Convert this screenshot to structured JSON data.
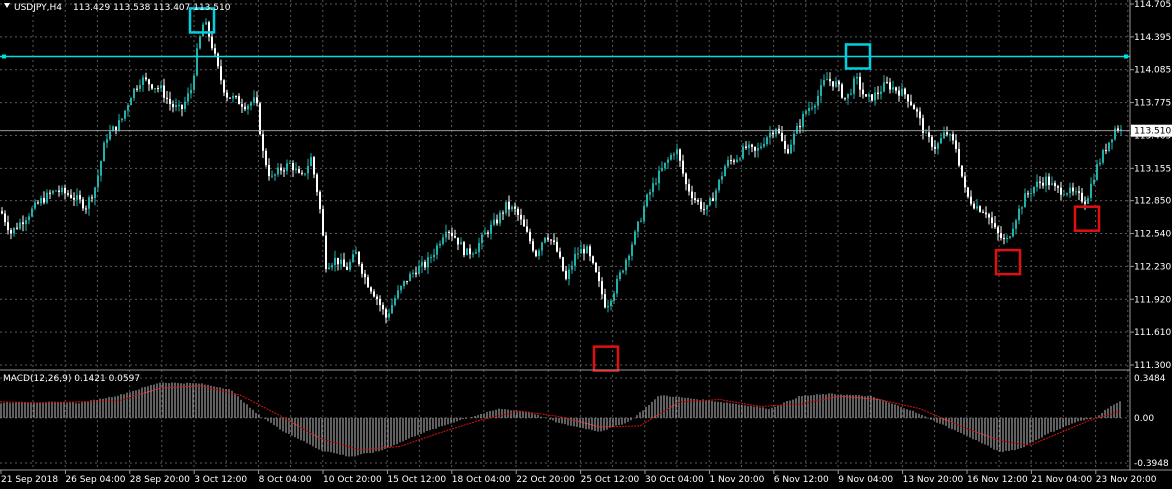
{
  "header": {
    "symbol": "USDJPY,H4",
    "ohlc": "113.429 113.538 113.407 113.510",
    "macd_label": "MACD(12,26,9) 0.1421 0.0597"
  },
  "colors": {
    "background": "#000000",
    "grid": "#5a5a5a",
    "bull": "#20b2aa",
    "bear": "#ffffff",
    "level_line": "#00e0e0",
    "peak_box": "#00d0e0",
    "trough_box": "#e01010",
    "signal": "#e01010",
    "histogram": "#c0c0c0"
  },
  "chart_data": [
    {
      "type": "candlestick",
      "symbol": "USDJPY",
      "timeframe": "H4",
      "ylim": [
        111.3,
        114.705
      ],
      "y_ticks": [
        "114.705",
        "114.395",
        "114.085",
        "113.775",
        "113.465",
        "113.155",
        "112.850",
        "112.540",
        "112.230",
        "111.920",
        "111.610",
        "111.300"
      ],
      "x_ticks": [
        "21 Sep 2018",
        "26 Sep 04:00",
        "28 Sep 20:00",
        "3 Oct 12:00",
        "8 Oct 04:00",
        "10 Oct 20:00",
        "15 Oct 12:00",
        "18 Oct 04:00",
        "22 Oct 20:00",
        "25 Oct 12:00",
        "30 Oct 04:00",
        "1 Nov 20:00",
        "6 Nov 12:00",
        "9 Nov 04:00",
        "13 Nov 20:00",
        "16 Nov 12:00",
        "21 Nov 04:00",
        "23 Nov 20:00"
      ],
      "current_price": "113.510",
      "horizontal_level": 114.21,
      "close_path": [
        [
          0,
          112.75
        ],
        [
          10,
          112.55
        ],
        [
          25,
          112.7
        ],
        [
          40,
          112.85
        ],
        [
          55,
          112.95
        ],
        [
          70,
          112.9
        ],
        [
          85,
          112.8
        ],
        [
          95,
          113.0
        ],
        [
          105,
          113.45
        ],
        [
          120,
          113.6
        ],
        [
          130,
          113.85
        ],
        [
          140,
          114.0
        ],
        [
          150,
          113.95
        ],
        [
          160,
          113.9
        ],
        [
          170,
          113.75
        ],
        [
          180,
          113.7
        ],
        [
          190,
          113.9
        ],
        [
          197,
          114.3
        ],
        [
          203,
          114.55
        ],
        [
          210,
          114.35
        ],
        [
          218,
          114.05
        ],
        [
          225,
          113.85
        ],
        [
          235,
          113.8
        ],
        [
          245,
          113.75
        ],
        [
          255,
          113.8
        ],
        [
          262,
          113.3
        ],
        [
          270,
          113.05
        ],
        [
          280,
          113.15
        ],
        [
          290,
          113.2
        ],
        [
          300,
          113.05
        ],
        [
          310,
          113.25
        ],
        [
          318,
          112.85
        ],
        [
          325,
          112.25
        ],
        [
          335,
          112.3
        ],
        [
          345,
          112.2
        ],
        [
          355,
          112.35
        ],
        [
          365,
          112.1
        ],
        [
          375,
          111.95
        ],
        [
          385,
          111.75
        ],
        [
          395,
          111.95
        ],
        [
          405,
          112.1
        ],
        [
          415,
          112.2
        ],
        [
          425,
          112.25
        ],
        [
          435,
          112.4
        ],
        [
          445,
          112.6
        ],
        [
          455,
          112.5
        ],
        [
          465,
          112.35
        ],
        [
          475,
          112.4
        ],
        [
          485,
          112.55
        ],
        [
          495,
          112.65
        ],
        [
          505,
          112.8
        ],
        [
          515,
          112.75
        ],
        [
          525,
          112.55
        ],
        [
          535,
          112.35
        ],
        [
          545,
          112.55
        ],
        [
          555,
          112.4
        ],
        [
          565,
          112.1
        ],
        [
          575,
          112.35
        ],
        [
          585,
          112.4
        ],
        [
          595,
          112.15
        ],
        [
          605,
          111.85
        ],
        [
          615,
          112.05
        ],
        [
          625,
          112.3
        ],
        [
          635,
          112.55
        ],
        [
          645,
          112.85
        ],
        [
          655,
          113.05
        ],
        [
          665,
          113.2
        ],
        [
          675,
          113.35
        ],
        [
          685,
          113.0
        ],
        [
          695,
          112.85
        ],
        [
          705,
          112.75
        ],
        [
          715,
          112.95
        ],
        [
          725,
          113.2
        ],
        [
          735,
          113.25
        ],
        [
          745,
          113.35
        ],
        [
          755,
          113.3
        ],
        [
          765,
          113.45
        ],
        [
          775,
          113.55
        ],
        [
          785,
          113.3
        ],
        [
          795,
          113.5
        ],
        [
          805,
          113.7
        ],
        [
          815,
          113.8
        ],
        [
          825,
          114.0
        ],
        [
          835,
          113.95
        ],
        [
          845,
          113.8
        ],
        [
          855,
          114.0
        ],
        [
          865,
          113.8
        ],
        [
          875,
          113.85
        ],
        [
          885,
          113.95
        ],
        [
          895,
          113.9
        ],
        [
          905,
          113.85
        ],
        [
          915,
          113.7
        ],
        [
          925,
          113.45
        ],
        [
          935,
          113.35
        ],
        [
          945,
          113.5
        ],
        [
          955,
          113.35
        ],
        [
          965,
          112.9
        ],
        [
          975,
          112.8
        ],
        [
          985,
          112.75
        ],
        [
          995,
          112.55
        ],
        [
          1005,
          112.45
        ],
        [
          1015,
          112.7
        ],
        [
          1025,
          112.9
        ],
        [
          1035,
          113.0
        ],
        [
          1045,
          113.05
        ],
        [
          1055,
          112.95
        ],
        [
          1065,
          112.95
        ],
        [
          1075,
          112.9
        ],
        [
          1085,
          112.85
        ],
        [
          1095,
          113.15
        ],
        [
          1105,
          113.35
        ],
        [
          1115,
          113.55
        ],
        [
          1120,
          113.51
        ]
      ],
      "annotations": [
        {
          "type": "peak-box",
          "x": 202,
          "price": 114.55
        },
        {
          "type": "peak-box",
          "x": 858,
          "price": 114.21
        },
        {
          "type": "trough-box",
          "x": 606,
          "price": 111.36
        },
        {
          "type": "trough-box",
          "x": 1008,
          "price": 112.27
        },
        {
          "type": "trough-box",
          "x": 1087,
          "price": 112.68
        }
      ]
    },
    {
      "type": "macd",
      "title": "MACD(12,26,9) 0.1421 0.0597",
      "ylim": [
        -0.3948,
        0.3484
      ],
      "y_ticks": [
        "0.3484",
        "0.00",
        "-0.3948"
      ],
      "histogram_path": [
        [
          0,
          0.13
        ],
        [
          40,
          0.14
        ],
        [
          80,
          0.13
        ],
        [
          120,
          0.2
        ],
        [
          160,
          0.31
        ],
        [
          200,
          0.3
        ],
        [
          230,
          0.25
        ],
        [
          255,
          0.05
        ],
        [
          280,
          -0.1
        ],
        [
          320,
          -0.28
        ],
        [
          350,
          -0.34
        ],
        [
          380,
          -0.29
        ],
        [
          420,
          -0.14
        ],
        [
          460,
          -0.02
        ],
        [
          500,
          0.08
        ],
        [
          530,
          0.05
        ],
        [
          560,
          -0.05
        ],
        [
          600,
          -0.12
        ],
        [
          630,
          -0.03
        ],
        [
          660,
          0.2
        ],
        [
          690,
          0.17
        ],
        [
          730,
          0.13
        ],
        [
          770,
          0.08
        ],
        [
          800,
          0.19
        ],
        [
          830,
          0.21
        ],
        [
          870,
          0.19
        ],
        [
          910,
          0.07
        ],
        [
          940,
          -0.05
        ],
        [
          970,
          -0.17
        ],
        [
          1000,
          -0.3
        ],
        [
          1020,
          -0.27
        ],
        [
          1050,
          -0.13
        ],
        [
          1075,
          -0.04
        ],
        [
          1095,
          0.0
        ],
        [
          1110,
          0.1
        ],
        [
          1120,
          0.14
        ]
      ],
      "signal_path": [
        [
          0,
          0.14
        ],
        [
          40,
          0.13
        ],
        [
          80,
          0.14
        ],
        [
          120,
          0.15
        ],
        [
          160,
          0.26
        ],
        [
          200,
          0.28
        ],
        [
          240,
          0.2
        ],
        [
          280,
          0.02
        ],
        [
          320,
          -0.18
        ],
        [
          360,
          -0.28
        ],
        [
          400,
          -0.25
        ],
        [
          440,
          -0.13
        ],
        [
          480,
          -0.02
        ],
        [
          520,
          0.06
        ],
        [
          560,
          0.01
        ],
        [
          600,
          -0.08
        ],
        [
          640,
          -0.07
        ],
        [
          680,
          0.14
        ],
        [
          720,
          0.16
        ],
        [
          760,
          0.1
        ],
        [
          800,
          0.12
        ],
        [
          840,
          0.19
        ],
        [
          880,
          0.16
        ],
        [
          920,
          0.08
        ],
        [
          960,
          -0.07
        ],
        [
          1000,
          -0.2
        ],
        [
          1030,
          -0.24
        ],
        [
          1060,
          -0.13
        ],
        [
          1090,
          -0.02
        ],
        [
          1110,
          0.03
        ],
        [
          1120,
          0.06
        ]
      ]
    }
  ]
}
